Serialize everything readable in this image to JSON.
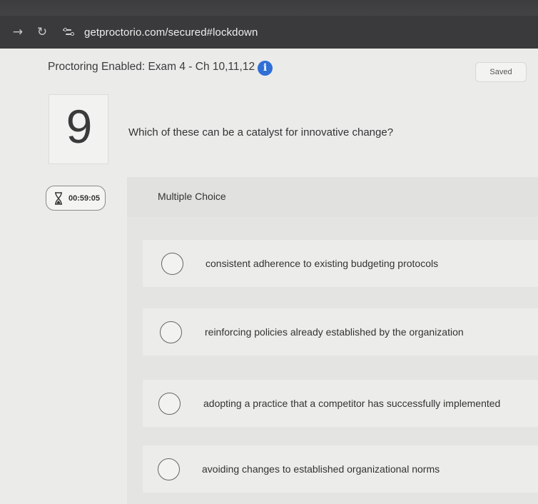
{
  "browser": {
    "url": "getproctorio.com/secured#lockdown",
    "forward_icon": "forward-arrow-icon",
    "reload_icon": "reload-icon",
    "site_info_icon": "site-settings-icon"
  },
  "header": {
    "title": "Proctoring Enabled: Exam 4 - Ch 10,11,12",
    "info_icon": "info-icon",
    "saved_label": "Saved"
  },
  "question": {
    "number": "9",
    "text": "Which of these can be a catalyst for innovative change?",
    "type_label": "Multiple Choice"
  },
  "timer": {
    "icon": "hourglass-icon",
    "value": "00:59:05"
  },
  "options": [
    {
      "label": "consistent adherence to existing budgeting protocols"
    },
    {
      "label": "reinforcing policies already established by the organization"
    },
    {
      "label": "adopting a practice that a competitor has successfully implemented"
    },
    {
      "label": "avoiding changes to established organizational norms"
    }
  ],
  "colors": {
    "info_accent": "#2f6fd6",
    "chrome_bg": "#3a3a3c",
    "page_bg": "#ebebea"
  }
}
